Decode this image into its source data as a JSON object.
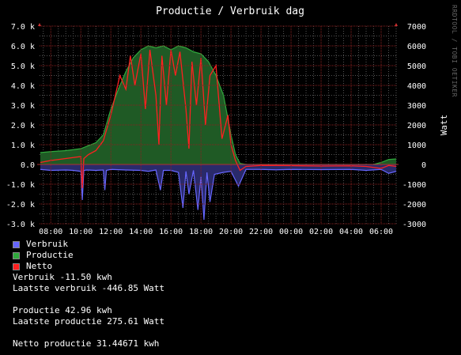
{
  "chart_data": {
    "type": "area",
    "title": "Productie / Verbruik dag",
    "ylabel_right": "Watt",
    "watermark": "RRDTOOL / TOBI OETIKER",
    "ylim": [
      -3000,
      7000
    ],
    "y_ticks_left": [
      "7.0 k",
      "6.0 k",
      "5.0 k",
      "4.0 k",
      "3.0 k",
      "2.0 k",
      "1.0 k",
      "0.0",
      "-1.0 k",
      "-2.0 k",
      "-3.0 k"
    ],
    "y_ticks_right": [
      "7000",
      "6000",
      "5000",
      "4000",
      "3000",
      "2000",
      "1000",
      "0",
      "-1000",
      "-2000",
      "-3000"
    ],
    "x_ticks": [
      "08:00",
      "10:00",
      "12:00",
      "14:00",
      "16:00",
      "18:00",
      "20:00",
      "22:00",
      "00:00",
      "02:00",
      "04:00",
      "06:00"
    ],
    "x_hours_range": [
      7.25,
      31.0
    ],
    "grid": true,
    "colors": {
      "verbruik": "#6666ff",
      "productie": "#2fa83c",
      "productie_fill": "#1f5a25",
      "netto": "#ff2020",
      "grid_major": "#8a2020",
      "grid_minor": "#555555"
    },
    "series": [
      {
        "name": "Verbruik",
        "x": [
          7.3,
          8,
          9,
          9.5,
          10,
          10.1,
          10.2,
          10.4,
          11,
          11.5,
          11.6,
          11.7,
          12,
          13,
          14,
          14.5,
          15,
          15.3,
          15.5,
          16,
          16.5,
          16.8,
          17,
          17.2,
          17.5,
          17.8,
          18,
          18.2,
          18.4,
          18.6,
          18.9,
          19.5,
          20,
          20.5,
          21,
          22,
          23,
          24,
          26,
          28,
          29,
          30,
          30.5,
          31
        ],
        "y": [
          -250,
          -300,
          -280,
          -300,
          -350,
          -1800,
          -300,
          -280,
          -300,
          -280,
          -1300,
          -300,
          -250,
          -280,
          -300,
          -350,
          -280,
          -1300,
          -300,
          -300,
          -400,
          -2200,
          -350,
          -1500,
          -300,
          -2300,
          -600,
          -2800,
          -400,
          -1900,
          -500,
          -400,
          -350,
          -1100,
          -250,
          -250,
          -270,
          -250,
          -260,
          -250,
          -300,
          -250,
          -450,
          -350
        ]
      },
      {
        "name": "Productie",
        "x": [
          7.3,
          8,
          9,
          10,
          11,
          11.5,
          12,
          12.5,
          13,
          13.5,
          14,
          14.5,
          15,
          15.5,
          16,
          16.5,
          17,
          17.5,
          18,
          18.5,
          19,
          19.5,
          20,
          20.3,
          20.6,
          21,
          22,
          24,
          26,
          28,
          29.5,
          30,
          30.5,
          31
        ],
        "y": [
          600,
          650,
          700,
          800,
          1100,
          1500,
          2800,
          3800,
          4700,
          5400,
          5800,
          6000,
          5900,
          6000,
          5800,
          6000,
          5900,
          5700,
          5600,
          5200,
          4500,
          3500,
          1500,
          500,
          50,
          0,
          0,
          0,
          0,
          0,
          0,
          100,
          250,
          280
        ]
      },
      {
        "name": "Netto",
        "x": [
          7.3,
          8,
          9,
          10,
          10.1,
          10.2,
          10.5,
          11,
          11.5,
          12,
          12.3,
          12.6,
          13,
          13.3,
          13.6,
          14,
          14.3,
          14.6,
          15,
          15.2,
          15.4,
          15.7,
          16,
          16.3,
          16.6,
          17,
          17.2,
          17.4,
          17.7,
          18,
          18.3,
          18.6,
          19,
          19.4,
          19.8,
          20,
          20.3,
          20.6,
          21,
          22,
          24,
          26,
          28,
          29,
          30,
          30.5,
          31
        ],
        "y": [
          100,
          200,
          300,
          400,
          -1200,
          300,
          500,
          700,
          1200,
          2500,
          3500,
          4500,
          3800,
          5500,
          4000,
          5600,
          2800,
          5800,
          3500,
          1000,
          5500,
          3000,
          5800,
          4500,
          5700,
          2800,
          800,
          5200,
          3000,
          5400,
          2000,
          4500,
          5000,
          1300,
          2500,
          1000,
          200,
          -300,
          -100,
          -50,
          -60,
          -80,
          -70,
          -100,
          -200,
          -50,
          -100
        ]
      }
    ]
  },
  "legend": [
    {
      "label": "Verbruik",
      "color": "#6666ff"
    },
    {
      "label": "Productie",
      "color": "#2fa83c"
    },
    {
      "label": "Netto",
      "color": "#ff2020"
    }
  ],
  "stats": {
    "verbruik_total": "Verbruik -11.50 kwh",
    "verbruik_laatste": "Laatste verbruik -446.85 Watt",
    "productie_total": "Productie 42.96 kwh",
    "productie_laatste": "Laatste productie 275.61 Watt",
    "netto_total": "Netto productie 31.44671 kwh"
  }
}
